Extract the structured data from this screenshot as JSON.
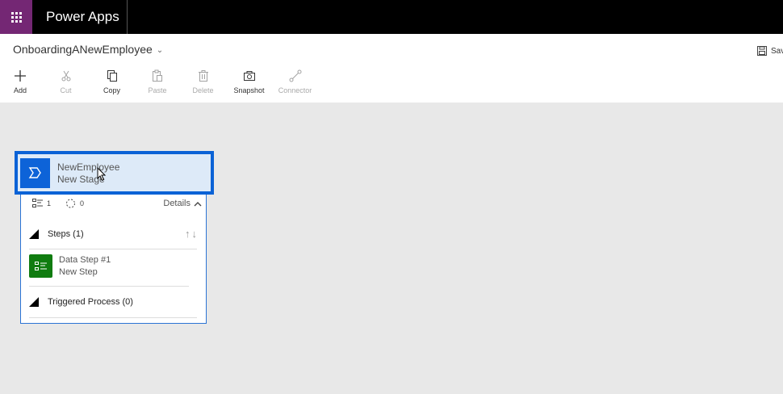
{
  "app": {
    "title": "Power Apps"
  },
  "process": {
    "name": "OnboardingANewEmployee"
  },
  "save_label": "Sav",
  "toolbar": [
    {
      "label": "Add",
      "icon": "plus-icon",
      "enabled": true
    },
    {
      "label": "Cut",
      "icon": "scissors-icon",
      "enabled": false
    },
    {
      "label": "Copy",
      "icon": "copy-icon",
      "enabled": true
    },
    {
      "label": "Paste",
      "icon": "paste-icon",
      "enabled": false
    },
    {
      "label": "Delete",
      "icon": "trash-icon",
      "enabled": false
    },
    {
      "label": "Snapshot",
      "icon": "camera-icon",
      "enabled": true
    },
    {
      "label": "Connector",
      "icon": "connector-icon",
      "enabled": false
    }
  ],
  "stage": {
    "title": "NewEmployee",
    "subtitle": "New Stage",
    "steps_count": "1",
    "processes_count": "0",
    "details_label": "Details",
    "steps_label": "Steps (1)",
    "step": {
      "title": "Data Step #1",
      "subtitle": "New Step"
    },
    "triggered_label": "Triggered Process (0)"
  },
  "colors": {
    "brand": "#742774",
    "stage_blue": "#0a62d6",
    "step_green": "#107c10"
  }
}
